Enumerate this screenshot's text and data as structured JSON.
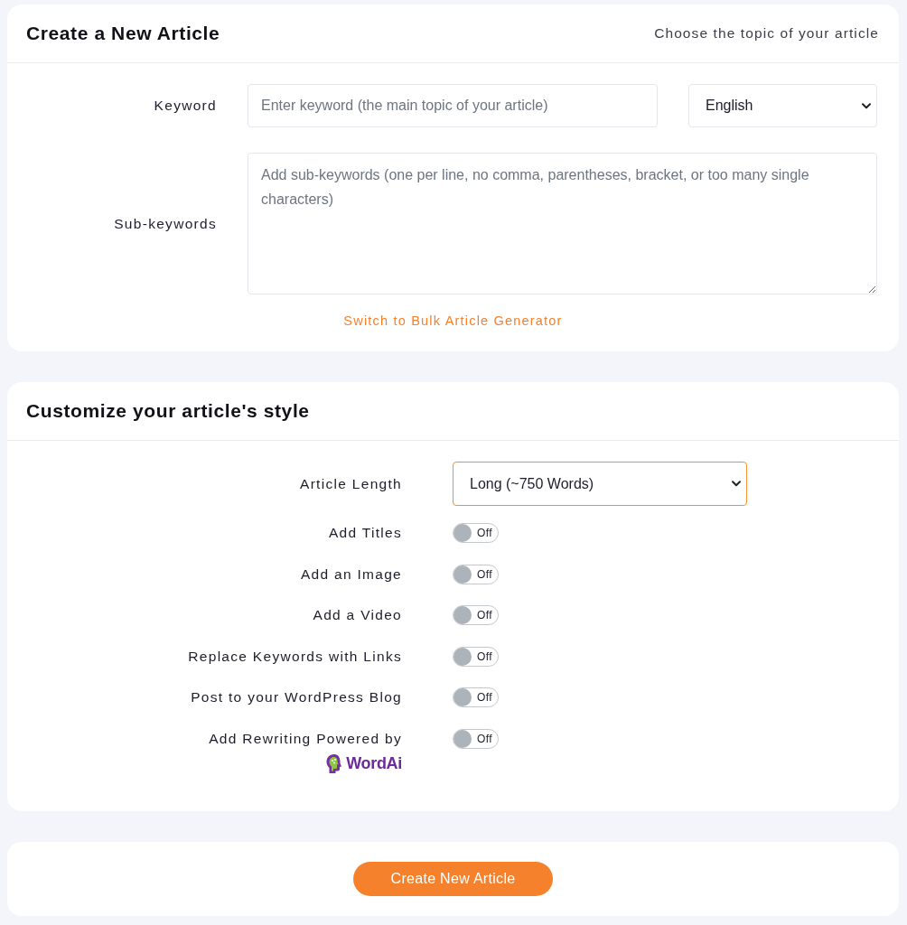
{
  "article_card": {
    "title": "Create a New Article",
    "subtitle": "Choose the topic of your article",
    "keyword": {
      "label": "Keyword",
      "placeholder": "Enter keyword (the main topic of your article)"
    },
    "language": {
      "value": "English"
    },
    "sub_keywords": {
      "label": "Sub-keywords",
      "placeholder": "Add sub-keywords (one per line, no comma, parentheses, bracket, or too many single characters)"
    },
    "bulk_link": "Switch to Bulk Article Generator"
  },
  "style_card": {
    "title": "Customize your article's style",
    "article_length": {
      "label": "Article Length",
      "value": "Long (~750 Words)",
      "focused": true
    },
    "options": [
      {
        "label": "Add Titles",
        "on": false,
        "state_text": "Off"
      },
      {
        "label": "Add an Image",
        "on": false,
        "state_text": "Off"
      },
      {
        "label": "Add a Video",
        "on": false,
        "state_text": "Off"
      },
      {
        "label": "Replace Keywords with Links",
        "on": false,
        "state_text": "Off"
      },
      {
        "label": "Post to your WordPress Blog",
        "on": false,
        "state_text": "Off"
      },
      {
        "label": "Add Rewriting Powered by",
        "on": false,
        "state_text": "Off",
        "logo": "WordAi"
      }
    ]
  },
  "submit": {
    "label": "Create New Article"
  }
}
